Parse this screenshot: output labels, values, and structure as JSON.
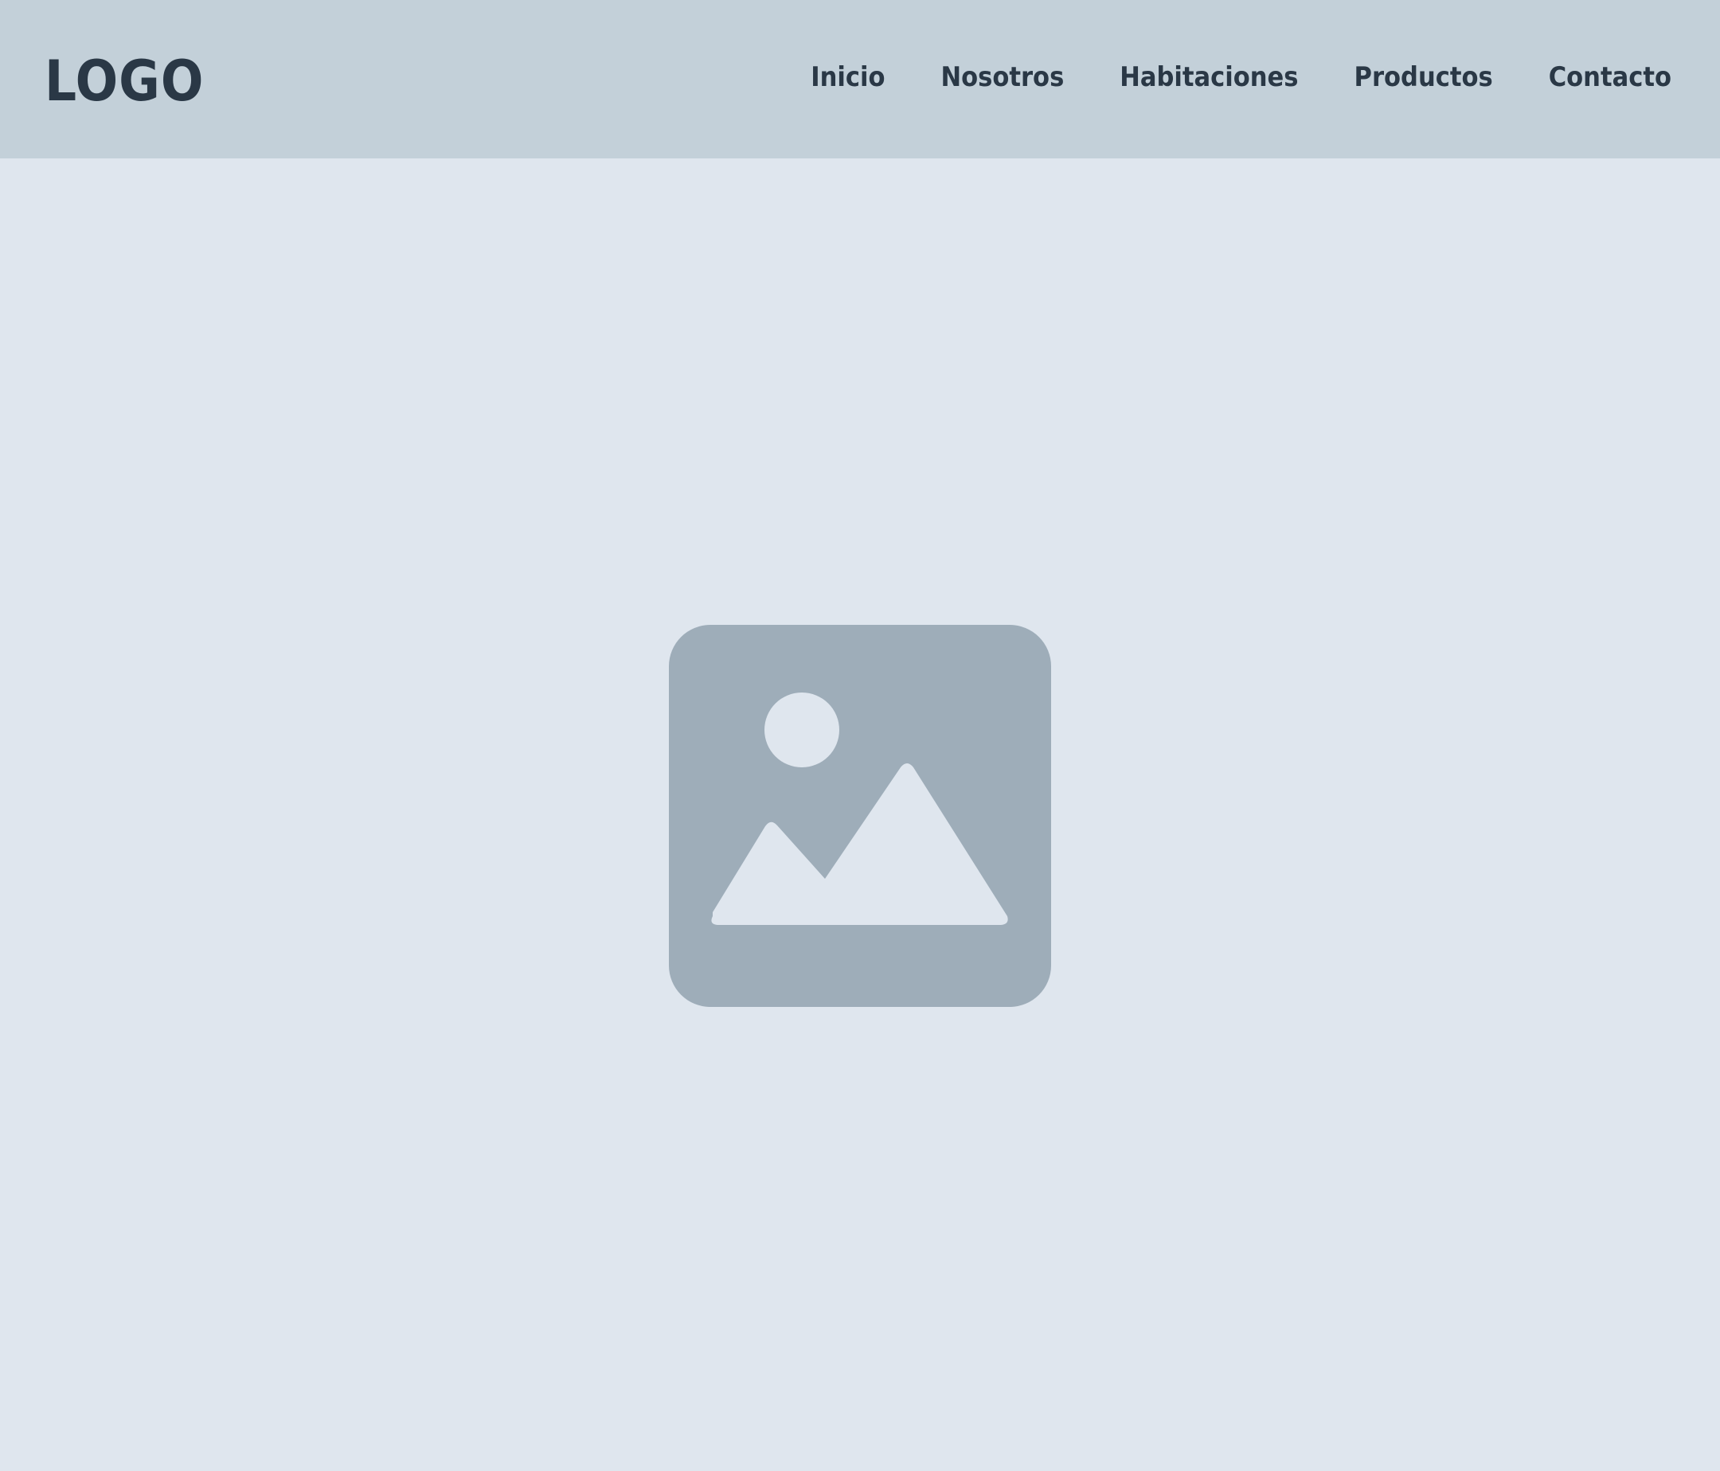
{
  "header": {
    "logo": "LOGO",
    "nav": [
      {
        "label": "Inicio"
      },
      {
        "label": "Nosotros"
      },
      {
        "label": "Habitaciones"
      },
      {
        "label": "Productos"
      },
      {
        "label": "Contacto"
      }
    ]
  },
  "hero": {
    "image_icon": "image-placeholder-icon"
  },
  "colors": {
    "header_bg": "#c3d0d9",
    "page_bg": "#dfe6ee",
    "text": "#2a3846",
    "placeholder": "#9eadb9"
  }
}
